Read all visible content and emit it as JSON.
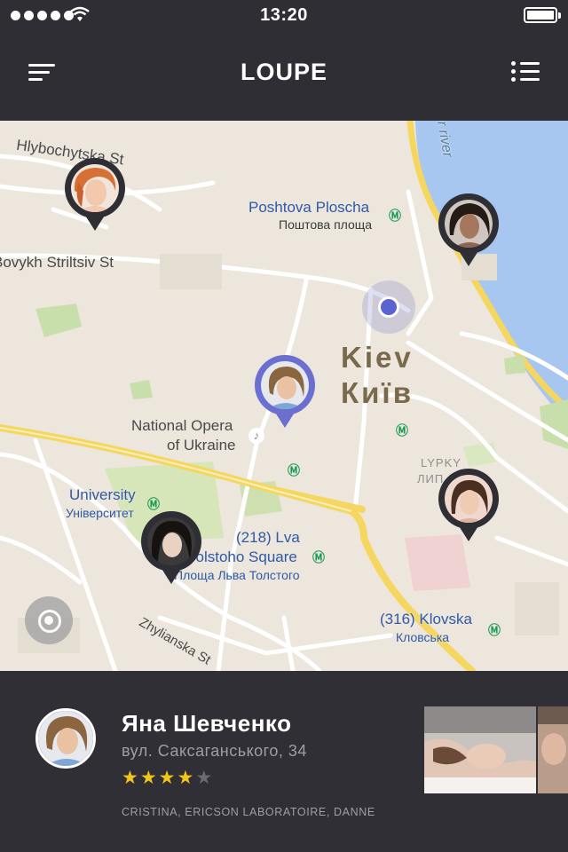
{
  "status_bar": {
    "time": "13:20"
  },
  "header": {
    "title": "LOUPE"
  },
  "map": {
    "labels": {
      "hlybochytska": "Hlybochytska St",
      "bovykh": "Bovykh Striltsiv St",
      "poshtova": "Poshtova Ploscha",
      "poshtova_uk": "Поштова площа",
      "river": "r river",
      "kiev": "Kiev",
      "kyiv": "Київ",
      "opera_line1": "National Opera",
      "opera_line2": "of Ukraine",
      "lypky": "LYPKY",
      "lypky_uk": "ЛИП",
      "university": "University",
      "university_uk": "Університет",
      "lva_line1": "(218) Lva",
      "lva_line2": "Tolstoho Square",
      "lva_uk": "Площа Льва Толстого",
      "klovska": "(316) Klovska",
      "klovska_uk": "Кловська",
      "zhylianska": "Zhylianska St"
    }
  },
  "profile": {
    "name": "Яна Шевченко",
    "address": "вул. Саксаганського, 34",
    "rating": 4,
    "rating_max": 5,
    "tags": "CRISTINA, ERICSON LABORATOIRE, DANNE",
    "stars": {
      "s1": "★",
      "s2": "★",
      "s3": "★",
      "s4": "★",
      "s5": "★"
    }
  },
  "colors": {
    "header_bg": "#2e2e34",
    "map_bg": "#ece6dc",
    "major_road": "#f5d65e",
    "river": "#a7c6f0",
    "selected_pin": "#6a6fd0",
    "default_pin": "#2e2e34",
    "star_on": "#f2c51a",
    "star_off": "#6b6b72"
  },
  "icons": {
    "menu": "menu-icon",
    "list": "list-icon",
    "locate": "locate-icon",
    "metro": "metro-icon",
    "music": "music-note-icon",
    "signal": "signal-icon",
    "wifi": "wifi-icon",
    "battery": "battery-icon"
  }
}
